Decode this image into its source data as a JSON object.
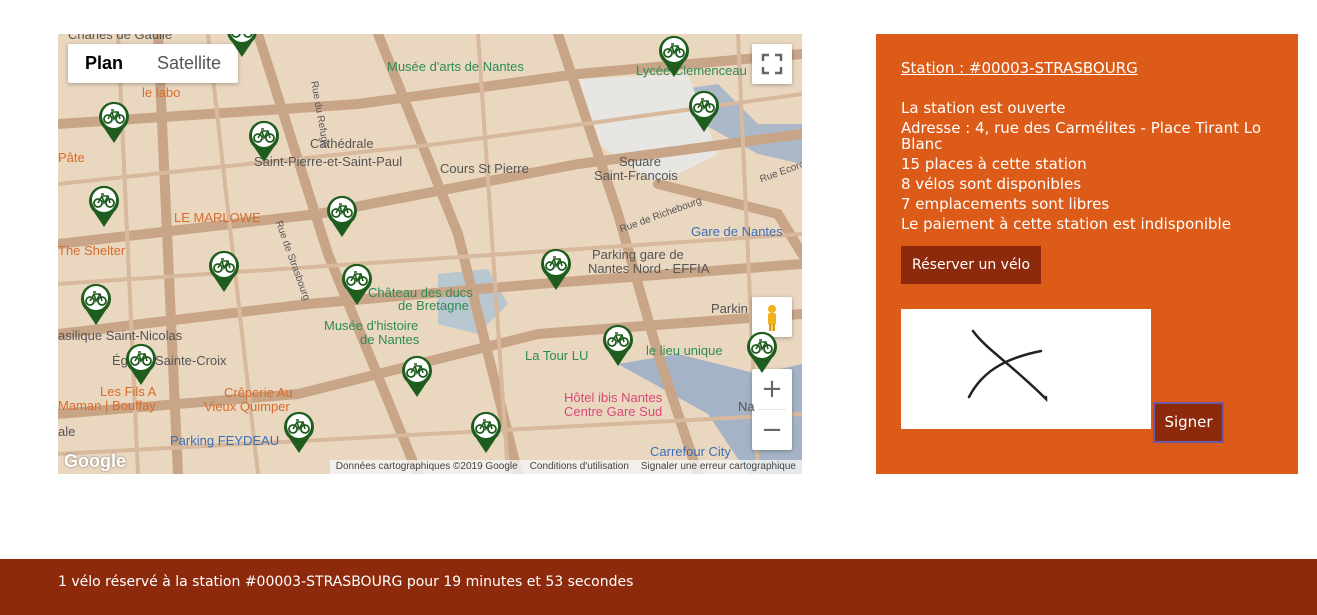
{
  "map": {
    "type_buttons": {
      "plan": "Plan",
      "satellite": "Satellite"
    },
    "labels": [
      "Charles de Gaulle",
      "le labo",
      "Musée d'arts de Nantes",
      "Lycée Clemenceau",
      "Cathédrale",
      "Saint-Pierre-et-Saint-Paul",
      "Cours St Pierre",
      "Square",
      "Saint-François",
      "Pâte",
      "LE MARLOWE",
      "Rue de Strasbourg",
      "Rue du Refuge",
      "Rue de Richebourg",
      "Rue Ecorchar",
      "Gare de Nantes",
      "The Shelter",
      "Parking gare de",
      "Nantes Nord - EFFIA",
      "Château des ducs",
      "de Bretagne",
      "Musée d'histoire",
      "de Nantes",
      "asilique Saint-Nicolas",
      "Sainte-Croix",
      "Parkin",
      "La Tour LU",
      "le lieu unique",
      "Crêperie Au",
      "Vieux Quimper",
      "Les Fils A",
      "Maman | Bouffay",
      "Hôtel ibis Nantes",
      "Centre Gare Sud",
      "Parking FEYDEAU",
      "Carrefour City",
      "ale",
      "Na",
      "Égl"
    ],
    "attribution": {
      "data": "Données cartographiques ©2019 Google",
      "terms": "Conditions d'utilisation",
      "report": "Signaler une erreur cartographique"
    },
    "google_logo": "Google",
    "zoom_in": "+",
    "zoom_out": "−"
  },
  "station": {
    "title": "Station : #00003-STRASBOURG",
    "status": "La station est ouverte",
    "address": "Adresse : 4, rue des Carmélites - Place Tirant Lo Blanc",
    "places": "15 places à cette station",
    "bikes": "8 vélos sont disponibles",
    "free": "7 emplacements sont libres",
    "payment": "Le paiement à cette station est indisponible",
    "reserve_label": "Réserver un vélo",
    "sign_label": "Signer"
  },
  "footer": {
    "text": "1 vélo réservé à la station #00003-STRASBOURG pour 19 minutes et 53 secondes"
  },
  "colors": {
    "panel": "#dc5b18",
    "button": "#8e2a0c",
    "footer": "#8e2a0c",
    "pin": "#1f5d1f"
  },
  "icons": [
    "bike-marker-icon",
    "fullscreen-icon",
    "pegman-icon",
    "zoom-in-icon",
    "zoom-out-icon"
  ]
}
